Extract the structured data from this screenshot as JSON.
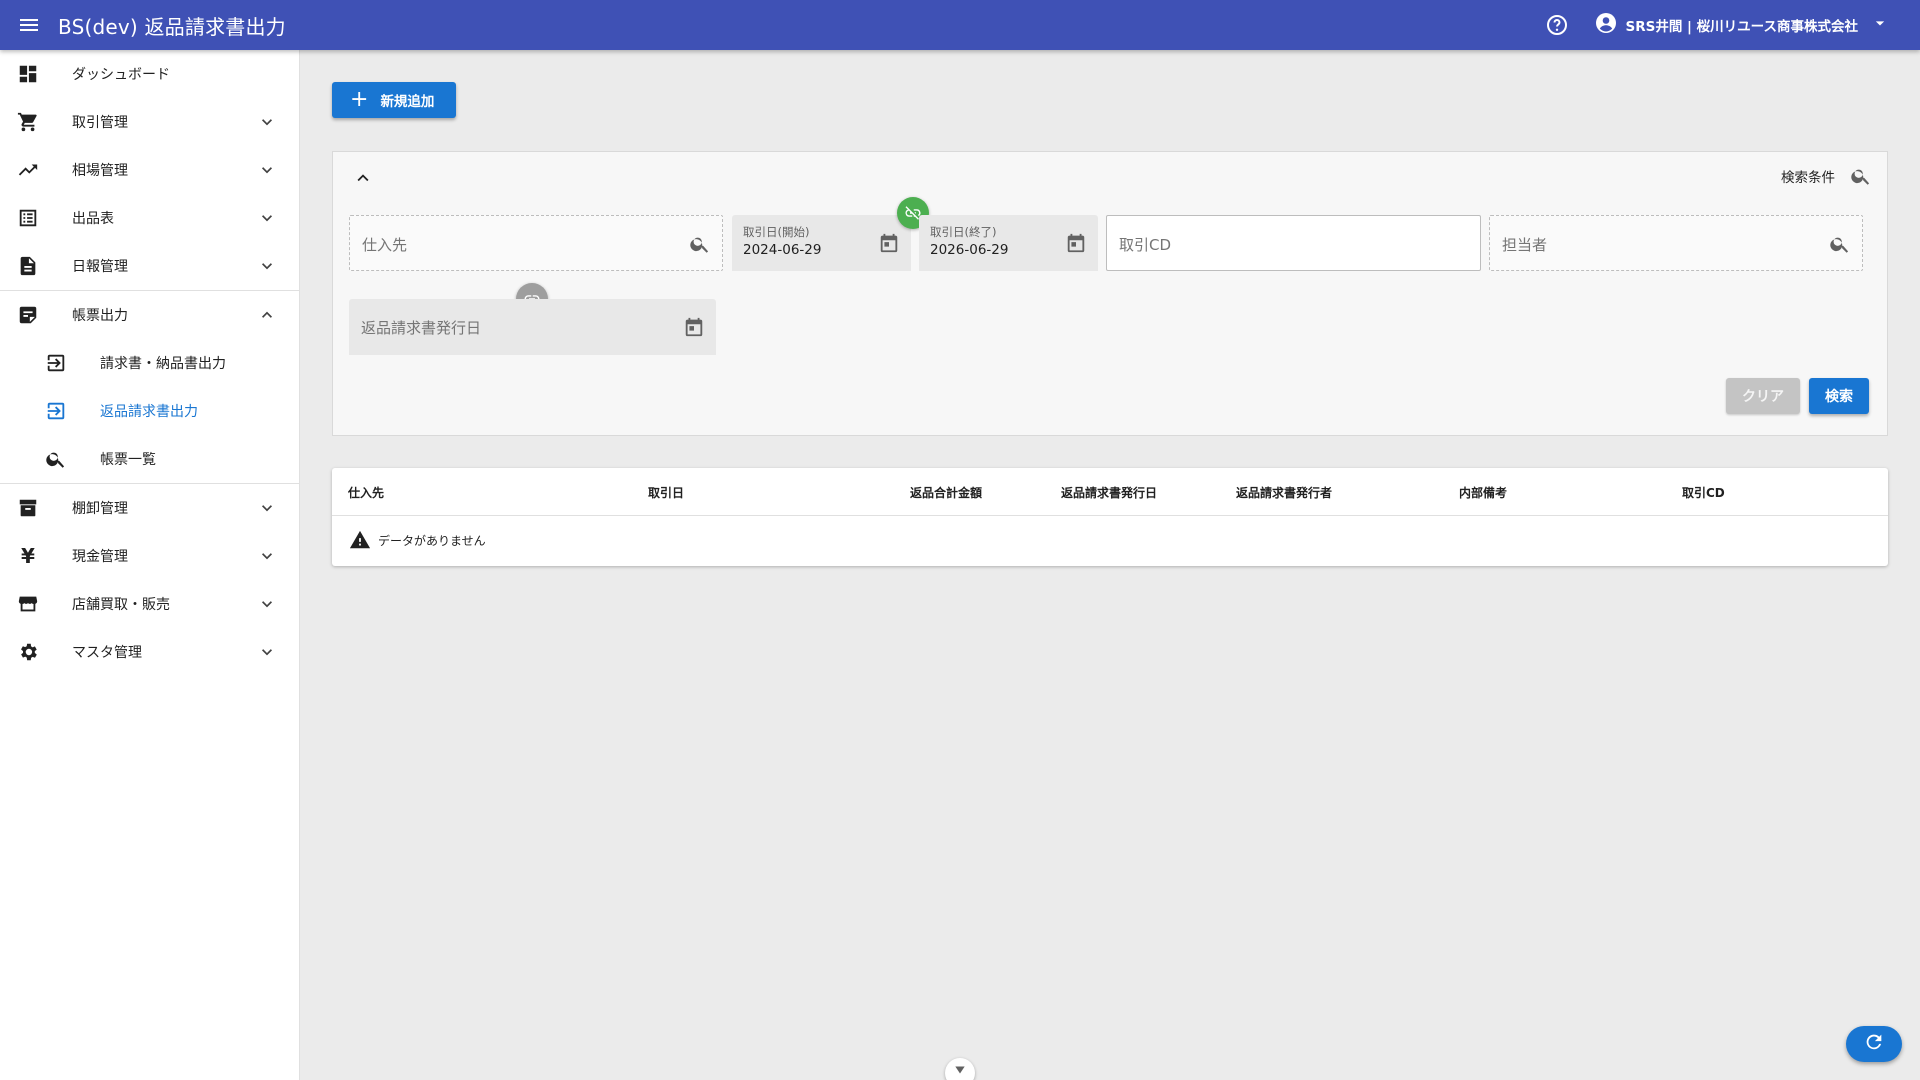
{
  "header": {
    "title": "BS(dev) 返品請求書出力",
    "user_name": "SRS井間 | 桜川リユース商事株式会社"
  },
  "sidebar": {
    "items": [
      {
        "label": "ダッシュボード",
        "icon": "dashboard-icon"
      },
      {
        "label": "取引管理",
        "icon": "cart-icon"
      },
      {
        "label": "相場管理",
        "icon": "trending-up-icon"
      },
      {
        "label": "出品表",
        "icon": "list-icon"
      },
      {
        "label": "日報管理",
        "icon": "document-icon"
      },
      {
        "label": "帳票出力",
        "icon": "report-icon",
        "expanded": true
      },
      {
        "label": "棚卸管理",
        "icon": "archive-icon"
      },
      {
        "label": "現金管理",
        "icon": "yen-icon"
      },
      {
        "label": "店舗買取・販売",
        "icon": "store-icon"
      },
      {
        "label": "マスタ管理",
        "icon": "gear-icon"
      }
    ],
    "sub_items": [
      {
        "label": "請求書・納品書出力",
        "icon": "export-icon"
      },
      {
        "label": "返品請求書出力",
        "icon": "export-icon",
        "active": true
      },
      {
        "label": "帳票一覧",
        "icon": "search-icon"
      }
    ]
  },
  "toolbar": {
    "add_label": "新規追加"
  },
  "filter": {
    "search_conditions_label": "検索条件",
    "supplier_placeholder": "仕入先",
    "date_start_label": "取引日(開始)",
    "date_start_value": "2024-06-29",
    "date_end_label": "取引日(終了)",
    "date_end_value": "2026-06-29",
    "trade_cd_placeholder": "取引CD",
    "staff_placeholder": "担当者",
    "issue_date_placeholder": "返品請求書発行日",
    "clear_label": "クリア",
    "search_label": "検索"
  },
  "table": {
    "columns": [
      "仕入先",
      "取引日",
      "返品合計金額",
      "返品請求書発行日",
      "返品請求書発行者",
      "内部備考",
      "取引CD"
    ],
    "empty_message": "データがありません"
  },
  "colors": {
    "primary": "#3f51b5",
    "accent": "#1976d2",
    "link_active": "#4caf50"
  }
}
